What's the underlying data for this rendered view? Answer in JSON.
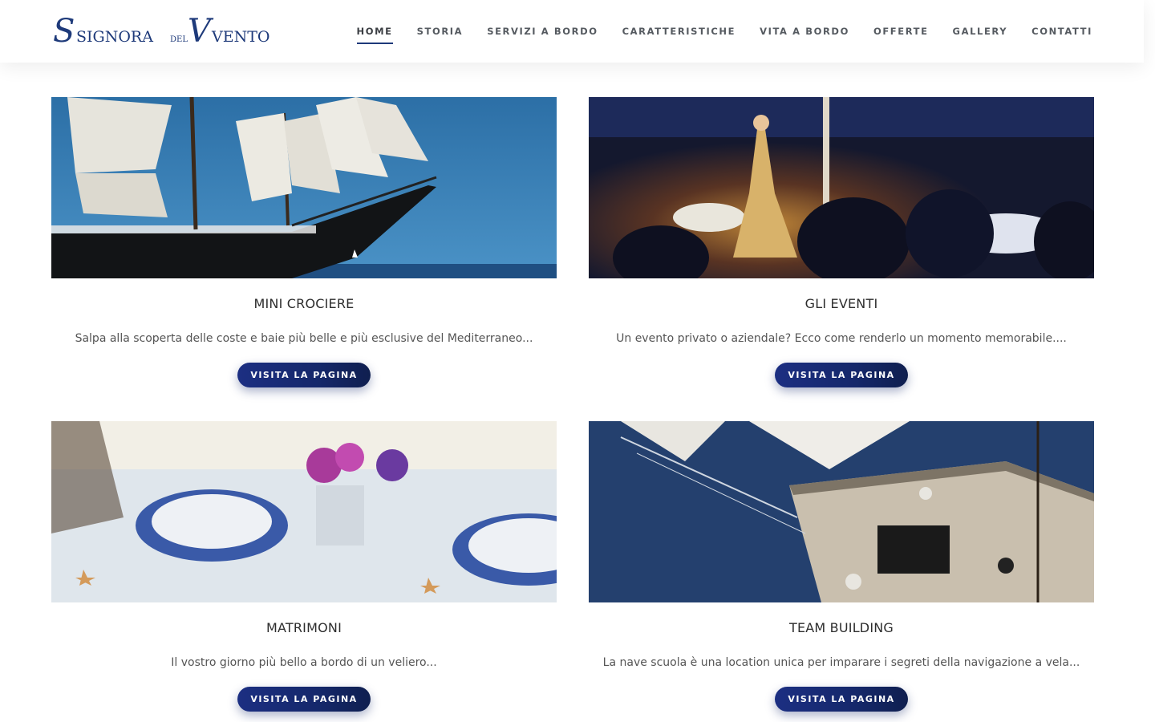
{
  "brand": {
    "logo_text_1": "Signora",
    "logo_text_2": "del",
    "logo_text_3": "Vento",
    "color": "#1e3a7a"
  },
  "nav": {
    "items": [
      {
        "label": "HOME",
        "active": true
      },
      {
        "label": "STORIA"
      },
      {
        "label": "SERVIZI A BORDO"
      },
      {
        "label": "CARATTERISTICHE"
      },
      {
        "label": "VITA A BORDO"
      },
      {
        "label": "OFFERTE"
      },
      {
        "label": "GALLERY"
      },
      {
        "label": "CONTATTI"
      }
    ]
  },
  "cards": [
    {
      "title": "MINI CROCIERE",
      "text": "Salpa alla scoperta delle coste e baie più belle e più esclusive del Mediterraneo...",
      "button": "VISITA LA PAGINA",
      "image": "sailing-ship-photo"
    },
    {
      "title": "GLI EVENTI",
      "text": "Un evento privato o aziendale? Ecco come renderlo un momento memorabile....",
      "button": "VISITA LA PAGINA",
      "image": "violinist-event-photo"
    },
    {
      "title": "MATRIMONI",
      "text": "Il vostro giorno più bello a bordo di un veliero...",
      "button": "VISITA LA PAGINA",
      "image": "wedding-table-photo"
    },
    {
      "title": "TEAM BUILDING",
      "text": "La nave scuola è una location unica per imparare i segreti della navigazione a vela...",
      "button": "VISITA LA PAGINA",
      "image": "ship-deck-aerial-photo"
    }
  ],
  "colors": {
    "button_start": "#1c2f82",
    "button_end": "#0f1f4f",
    "active_underline": "#1e3a7a"
  }
}
